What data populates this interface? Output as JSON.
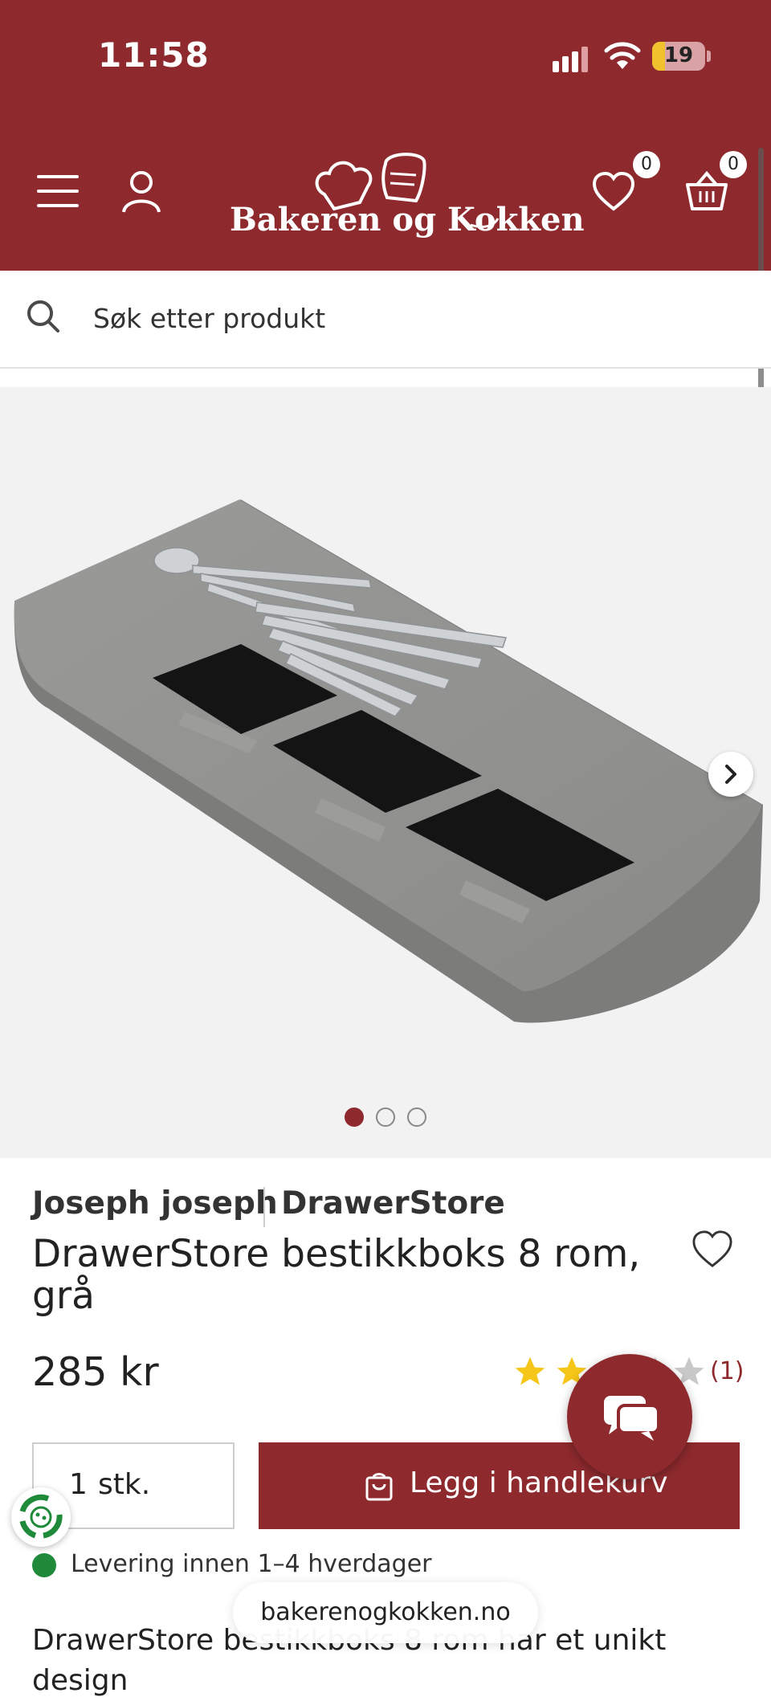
{
  "status_bar": {
    "time": "11:58",
    "battery": "19"
  },
  "header": {
    "logo_text": "Bakeren og Kokken",
    "wishlist_count": "0",
    "cart_count": "0"
  },
  "search": {
    "placeholder": "Søk etter produkt"
  },
  "gallery": {
    "slides": 3,
    "active_slide": 1
  },
  "product": {
    "brand": "Joseph joseph",
    "series": "DrawerStore",
    "title": "DrawerStore bestikkboks 8 rom, grå",
    "price": "285 kr",
    "rating": 3,
    "rating_max": 5,
    "review_count": "(1)",
    "quantity": "1",
    "quantity_unit": "stk.",
    "add_to_cart_label": "Legg i handlekurv",
    "shipping_text": "Levering innen 1–4 hverdager",
    "description": "DrawerStore bestikkboks 8 rom har et unikt design"
  },
  "browser": {
    "domain": "bakerenogkokken.no"
  },
  "colors": {
    "brand": "#8e2a2e",
    "stock_ok": "#1f8a3a",
    "star": "#f5c518"
  }
}
